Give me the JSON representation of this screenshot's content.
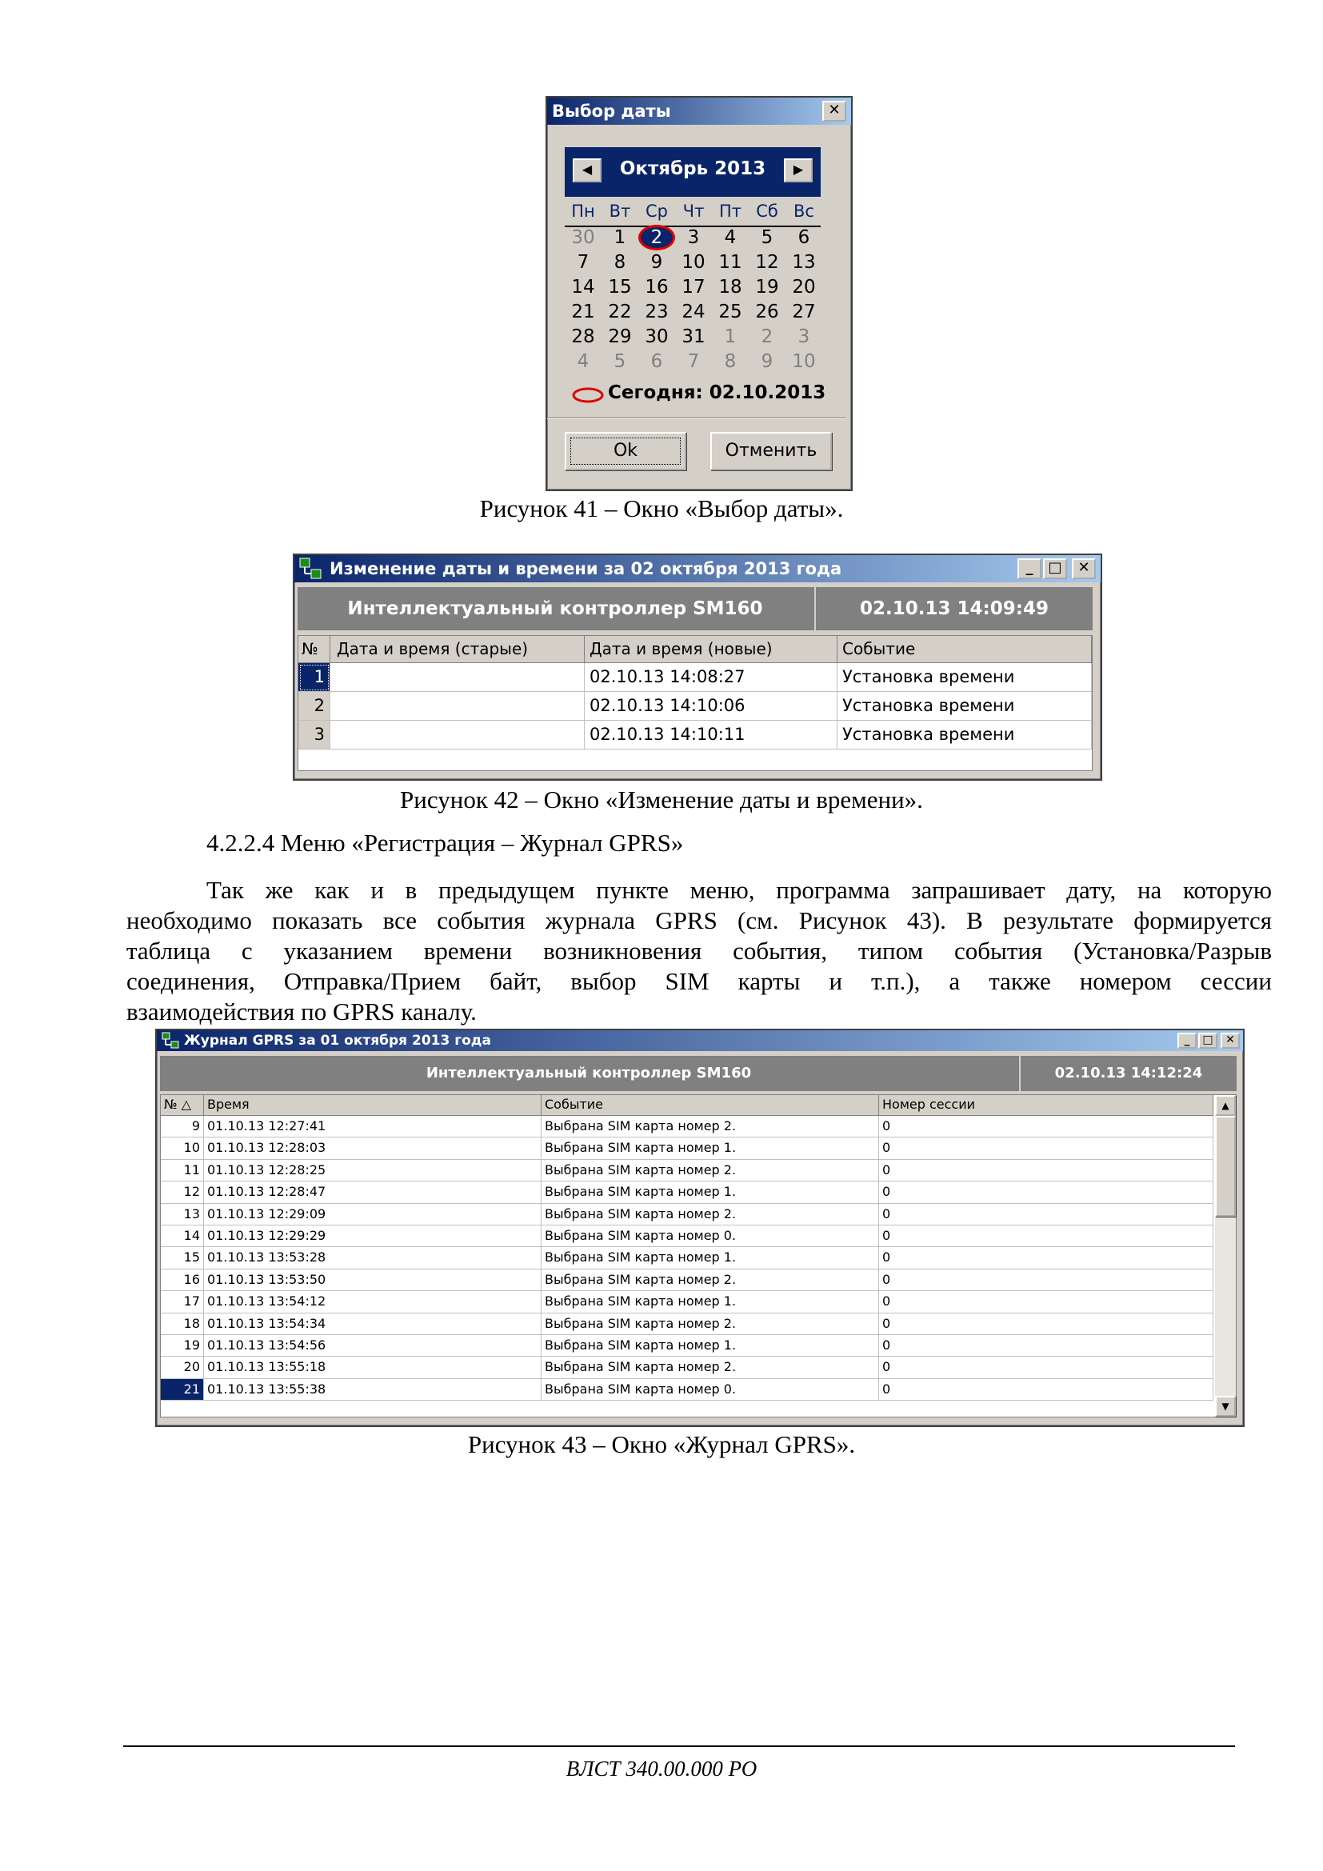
{
  "date_dialog": {
    "title": "Выбор даты",
    "month_label": "Октябрь 2013",
    "weekdays": [
      "Пн",
      "Вт",
      "Ср",
      "Чт",
      "Пт",
      "Сб",
      "Вс"
    ],
    "weeks": [
      [
        "30",
        "1",
        "2",
        "3",
        "4",
        "5",
        "6"
      ],
      [
        "7",
        "8",
        "9",
        "10",
        "11",
        "12",
        "13"
      ],
      [
        "14",
        "15",
        "16",
        "17",
        "18",
        "19",
        "20"
      ],
      [
        "21",
        "22",
        "23",
        "24",
        "25",
        "26",
        "27"
      ],
      [
        "28",
        "29",
        "30",
        "31",
        "1",
        "2",
        "3"
      ],
      [
        "4",
        "5",
        "6",
        "7",
        "8",
        "9",
        "10"
      ]
    ],
    "today_label": "Сегодня: 02.10.2013",
    "ok_label": "Ok",
    "cancel_label": "Отменить",
    "caption": "Рисунок 41 – Окно «Выбор даты»."
  },
  "time_window": {
    "title": "Изменение даты и времени за 02 октября 2013 года",
    "device": "Интеллектуальный контроллер SM160",
    "timestamp": "02.10.13 14:09:49",
    "columns": [
      "№",
      "Дата и время (старые)",
      "Дата и время (новые)",
      "Событие"
    ],
    "rows": [
      [
        "1",
        "",
        "02.10.13 14:08:27",
        "Установка времени"
      ],
      [
        "2",
        "",
        "02.10.13 14:10:06",
        "Установка времени"
      ],
      [
        "3",
        "",
        "02.10.13 14:10:11",
        "Установка времени"
      ]
    ],
    "caption": "Рисунок 42 – Окно «Изменение даты и времени»."
  },
  "section": {
    "heading": "4.2.2.4 Меню «Регистрация – Журнал GPRS»",
    "lines": [
      "Так же как и в предыдущем пункте меню, программа запрашивает дату, на которую",
      "необходимо показать все события журнала GPRS (см. Рисунок 43). В результате формируется",
      "таблица с указанием времени возникновения события, типом события (Установка/Разрыв",
      "соединения, Отправка/Прием байт, выбор SIM карты и т.п.), а также номером сессии",
      "взаимодействия по GPRS каналу."
    ]
  },
  "gprs_window": {
    "title": "Журнал GPRS за 01 октября 2013 года",
    "device": "Интеллектуальный контроллер SM160",
    "timestamp": "02.10.13 14:12:24",
    "columns": [
      "№ △",
      "Время",
      "Событие",
      "Номер сессии"
    ],
    "rows": [
      [
        "9",
        "01.10.13 12:27:41",
        "Выбрана SIM карта номер 2.",
        "0"
      ],
      [
        "10",
        "01.10.13 12:28:03",
        "Выбрана SIM карта номер 1.",
        "0"
      ],
      [
        "11",
        "01.10.13 12:28:25",
        "Выбрана SIM карта номер 2.",
        "0"
      ],
      [
        "12",
        "01.10.13 12:28:47",
        "Выбрана SIM карта номер 1.",
        "0"
      ],
      [
        "13",
        "01.10.13 12:29:09",
        "Выбрана SIM карта номер 2.",
        "0"
      ],
      [
        "14",
        "01.10.13 12:29:29",
        "Выбрана SIM карта номер 0.",
        "0"
      ],
      [
        "15",
        "01.10.13 13:53:28",
        "Выбрана SIM карта номер 1.",
        "0"
      ],
      [
        "16",
        "01.10.13 13:53:50",
        "Выбрана SIM карта номер 2.",
        "0"
      ],
      [
        "17",
        "01.10.13 13:54:12",
        "Выбрана SIM карта номер 1.",
        "0"
      ],
      [
        "18",
        "01.10.13 13:54:34",
        "Выбрана SIM карта номер 2.",
        "0"
      ],
      [
        "19",
        "01.10.13 13:54:56",
        "Выбрана SIM карта номер 1.",
        "0"
      ],
      [
        "20",
        "01.10.13 13:55:18",
        "Выбрана SIM карта номер 2.",
        "0"
      ],
      [
        "21",
        "01.10.13 13:55:38",
        "Выбрана SIM карта номер 0.",
        "0"
      ]
    ],
    "caption": "Рисунок 43 – Окно «Журнал GPRS»."
  },
  "footer": {
    "doc_code": "ВЛСТ 340.00.000 РО"
  },
  "colors": {
    "title_gradient_start": "#0a246a",
    "title_gradient_end": "#a6caf0",
    "window_face": "#d4d0c8",
    "header_band": "#808080",
    "today_circle": "#e00000"
  },
  "icons": {
    "close": "close-icon",
    "minimize": "minimize-icon",
    "maximize": "maximize-icon",
    "prev_month": "arrow-left-icon",
    "next_month": "arrow-right-icon",
    "app": "app-icon",
    "scroll_up": "scroll-up-icon",
    "scroll_down": "scroll-down-icon"
  }
}
